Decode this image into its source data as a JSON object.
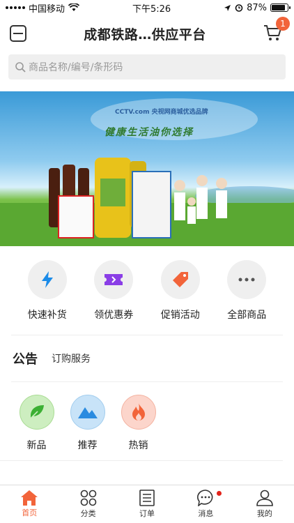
{
  "status": {
    "carrier": "中国移动",
    "time": "下午5:26",
    "battery": "87%"
  },
  "header": {
    "title": "成都铁路…供应平台",
    "cart_count": "1"
  },
  "search": {
    "placeholder": "商品名称/编号/条形码"
  },
  "banner": {
    "cctv": "CCTV.com 央视网商城优选品牌",
    "slogan": "健康生活油你选择"
  },
  "quick_actions": [
    {
      "label": "快速补货",
      "icon": "lightning-icon"
    },
    {
      "label": "领优惠券",
      "icon": "ticket-icon"
    },
    {
      "label": "促销活动",
      "icon": "tag-icon"
    },
    {
      "label": "全部商品",
      "icon": "more-icon"
    }
  ],
  "notice": {
    "head": "公告",
    "text": "订购服务"
  },
  "categories": [
    {
      "label": "新品",
      "icon": "leaf-icon",
      "color": "#3cb034"
    },
    {
      "label": "推荐",
      "icon": "mountain-icon",
      "color": "#2a8be0"
    },
    {
      "label": "热销",
      "icon": "flame-icon",
      "color": "#f2643a"
    }
  ],
  "tabs": [
    {
      "label": "首页",
      "icon": "home-icon"
    },
    {
      "label": "分类",
      "icon": "category-icon"
    },
    {
      "label": "订单",
      "icon": "order-icon"
    },
    {
      "label": "消息",
      "icon": "message-icon"
    },
    {
      "label": "我的",
      "icon": "user-icon"
    }
  ],
  "colors": {
    "accent": "#f2643a"
  }
}
